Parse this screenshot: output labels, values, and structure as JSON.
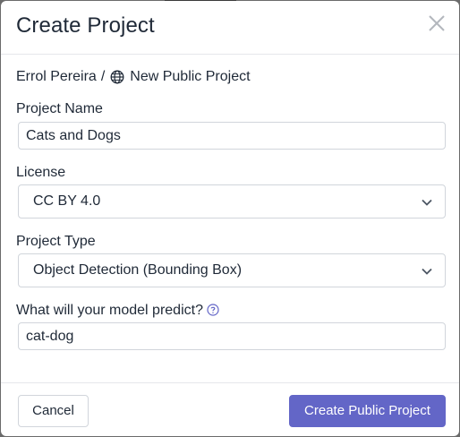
{
  "dialog": {
    "title": "Create Project",
    "close_icon": "close-icon"
  },
  "breadcrumb": {
    "owner": "Errol Pereira",
    "separator": "/",
    "icon": "globe-icon",
    "project": "New Public Project"
  },
  "form": {
    "project_name": {
      "label": "Project Name",
      "value": "Cats and Dogs"
    },
    "license": {
      "label": "License",
      "value": "CC BY 4.0",
      "icon": "chevron-down-icon"
    },
    "project_type": {
      "label": "Project Type",
      "value": "Object Detection (Bounding Box)",
      "icon": "chevron-down-icon"
    },
    "predict": {
      "label": "What will your model predict?",
      "value": "cat-dog",
      "help_icon": "question-circle-icon"
    }
  },
  "footer": {
    "cancel_label": "Cancel",
    "submit_label": "Create Public Project"
  },
  "colors": {
    "primary": "#6366c7",
    "border": "#d1d5db",
    "text": "#1f2937"
  }
}
